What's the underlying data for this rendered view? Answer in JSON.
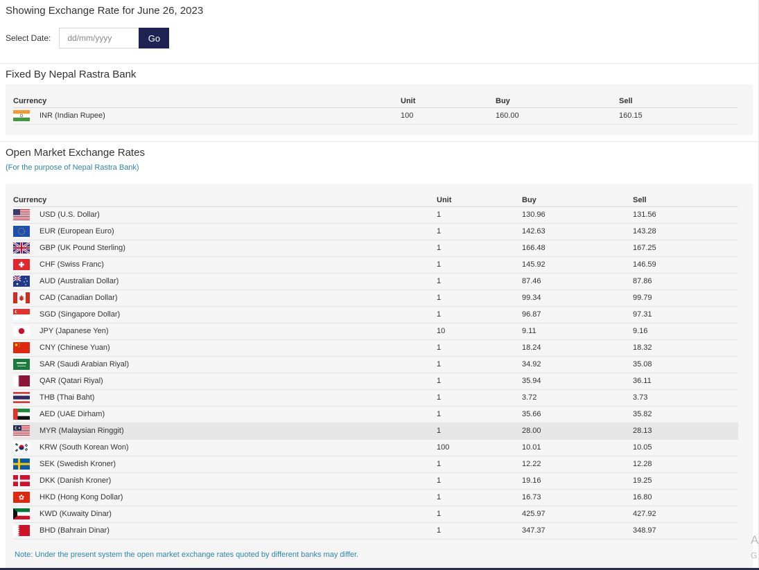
{
  "header": {
    "title": "Showing Exchange Rate for June 26, 2023",
    "select_date_label": "Select Date:",
    "date_placeholder": "dd/mm/yyyy",
    "go_label": "Go"
  },
  "fixed": {
    "title": "Fixed By Nepal Rastra Bank",
    "columns": [
      "Currency",
      "Unit",
      "Buy",
      "Sell"
    ],
    "rows": [
      {
        "flag": "india-flag-icon",
        "currency": "INR (Indian Rupee)",
        "unit": "100",
        "buy": "160.00",
        "sell": "160.15"
      }
    ]
  },
  "open_market": {
    "title": "Open Market Exchange Rates",
    "subtitle": "(For the purpose of Nepal Rastra Bank)",
    "columns": [
      "Currency",
      "Unit",
      "Buy",
      "Sell"
    ],
    "rows": [
      {
        "flag": "usa-flag-icon",
        "currency": "USD (U.S. Dollar)",
        "unit": "1",
        "buy": "130.96",
        "sell": "131.56"
      },
      {
        "flag": "eu-flag-icon",
        "currency": "EUR (European Euro)",
        "unit": "1",
        "buy": "142.63",
        "sell": "143.28"
      },
      {
        "flag": "uk-flag-icon",
        "currency": "GBP (UK Pound Sterling)",
        "unit": "1",
        "buy": "166.48",
        "sell": "167.25"
      },
      {
        "flag": "switzerland-flag-icon",
        "currency": "CHF (Swiss Franc)",
        "unit": "1",
        "buy": "145.92",
        "sell": "146.59"
      },
      {
        "flag": "australia-flag-icon",
        "currency": "AUD (Australian Dollar)",
        "unit": "1",
        "buy": "87.46",
        "sell": "87.86"
      },
      {
        "flag": "canada-flag-icon",
        "currency": "CAD (Canadian Dollar)",
        "unit": "1",
        "buy": "99.34",
        "sell": "99.79"
      },
      {
        "flag": "singapore-flag-icon",
        "currency": "SGD (Singapore Dollar)",
        "unit": "1",
        "buy": "96.87",
        "sell": "97.31"
      },
      {
        "flag": "japan-flag-icon",
        "currency": "JPY (Japanese Yen)",
        "unit": "10",
        "buy": "9.11",
        "sell": "9.16"
      },
      {
        "flag": "china-flag-icon",
        "currency": "CNY (Chinese Yuan)",
        "unit": "1",
        "buy": "18.24",
        "sell": "18.32"
      },
      {
        "flag": "saudi-flag-icon",
        "currency": "SAR (Saudi Arabian Riyal)",
        "unit": "1",
        "buy": "34.92",
        "sell": "35.08"
      },
      {
        "flag": "qatar-flag-icon",
        "currency": "QAR (Qatari Riyal)",
        "unit": "1",
        "buy": "35.94",
        "sell": "36.11"
      },
      {
        "flag": "thailand-flag-icon",
        "currency": "THB (Thai Baht)",
        "unit": "1",
        "buy": "3.72",
        "sell": "3.73"
      },
      {
        "flag": "uae-flag-icon",
        "currency": "AED (UAE Dirham)",
        "unit": "1",
        "buy": "35.66",
        "sell": "35.82"
      },
      {
        "flag": "malaysia-flag-icon",
        "currency": "MYR (Malaysian Ringgit)",
        "unit": "1",
        "buy": "28.00",
        "sell": "28.13"
      },
      {
        "flag": "south-korea-flag-icon",
        "currency": "KRW (South Korean Won)",
        "unit": "100",
        "buy": "10.01",
        "sell": "10.05"
      },
      {
        "flag": "sweden-flag-icon",
        "currency": "SEK (Swedish Kroner)",
        "unit": "1",
        "buy": "12.22",
        "sell": "12.28"
      },
      {
        "flag": "denmark-flag-icon",
        "currency": "DKK (Danish Kroner)",
        "unit": "1",
        "buy": "19.16",
        "sell": "19.25"
      },
      {
        "flag": "hong-kong-flag-icon",
        "currency": "HKD (Hong Kong Dollar)",
        "unit": "1",
        "buy": "16.73",
        "sell": "16.80"
      },
      {
        "flag": "kuwait-flag-icon",
        "currency": "KWD (Kuwaity Dinar)",
        "unit": "1",
        "buy": "425.97",
        "sell": "427.92"
      },
      {
        "flag": "bahrain-flag-icon",
        "currency": "BHD (Bahrain Dinar)",
        "unit": "1",
        "buy": "347.37",
        "sell": "348.97"
      }
    ],
    "highlighted_row": "MYR (Malaysian Ringgit)",
    "note": "Note: Under the present system the open market exchange rates quoted by different banks may differ."
  },
  "edge": {
    "a": "A",
    "g": "G"
  },
  "colors": {
    "button": "#1f2354",
    "link": "#2e87a6",
    "panel": "#f5f5f5",
    "highlight": "#e6e6e6"
  }
}
